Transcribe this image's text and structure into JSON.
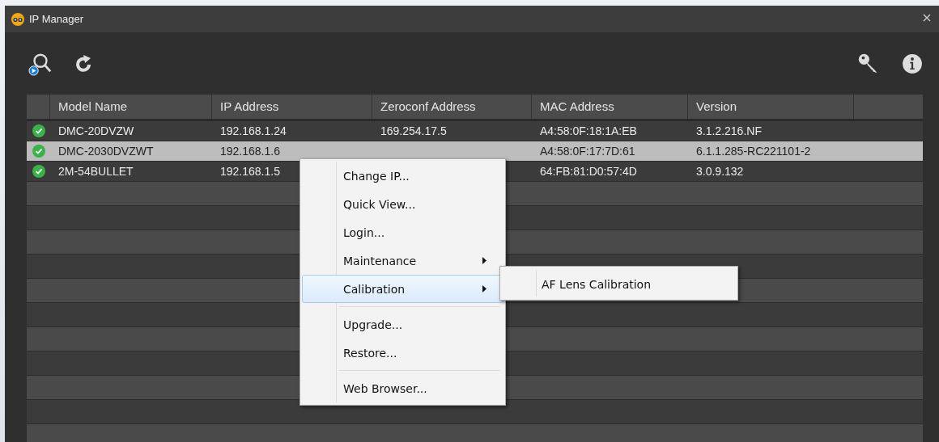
{
  "window": {
    "title": "IP Manager"
  },
  "table": {
    "columns": [
      "Model Name",
      "IP Address",
      "Zeroconf Address",
      "MAC Address",
      "Version"
    ],
    "rows": [
      {
        "connected": true,
        "selected": false,
        "cells": [
          "DMC-20DVZW",
          "192.168.1.24",
          "169.254.17.5",
          "A4:58:0F:18:1A:EB",
          "3.1.2.216.NF"
        ]
      },
      {
        "connected": true,
        "selected": true,
        "cells": [
          "DMC-2030DVZWT",
          "192.168.1.6",
          "",
          "A4:58:0F:17:7D:61",
          "6.1.1.285-RC221101-2"
        ]
      },
      {
        "connected": true,
        "selected": false,
        "cells": [
          "2M-54BULLET",
          "192.168.1.5",
          "",
          "64:FB:81:D0:57:4D",
          "3.0.9.132"
        ]
      }
    ]
  },
  "context_menu": {
    "items": [
      {
        "kind": "item",
        "label": "Change IP...",
        "submenu": false,
        "selected": false
      },
      {
        "kind": "item",
        "label": "Quick View...",
        "submenu": false,
        "selected": false
      },
      {
        "kind": "item",
        "label": "Login...",
        "submenu": false,
        "selected": false
      },
      {
        "kind": "item",
        "label": "Maintenance",
        "submenu": true,
        "selected": false
      },
      {
        "kind": "item",
        "label": "Calibration",
        "submenu": true,
        "selected": true
      },
      {
        "kind": "separator"
      },
      {
        "kind": "item",
        "label": "Upgrade...",
        "submenu": false,
        "selected": false
      },
      {
        "kind": "item",
        "label": "Restore...",
        "submenu": false,
        "selected": false
      },
      {
        "kind": "separator"
      },
      {
        "kind": "item",
        "label": "Web Browser...",
        "submenu": false,
        "selected": false
      }
    ]
  },
  "submenu": {
    "items": [
      {
        "label": "AF Lens Calibration",
        "selected": false
      }
    ]
  }
}
